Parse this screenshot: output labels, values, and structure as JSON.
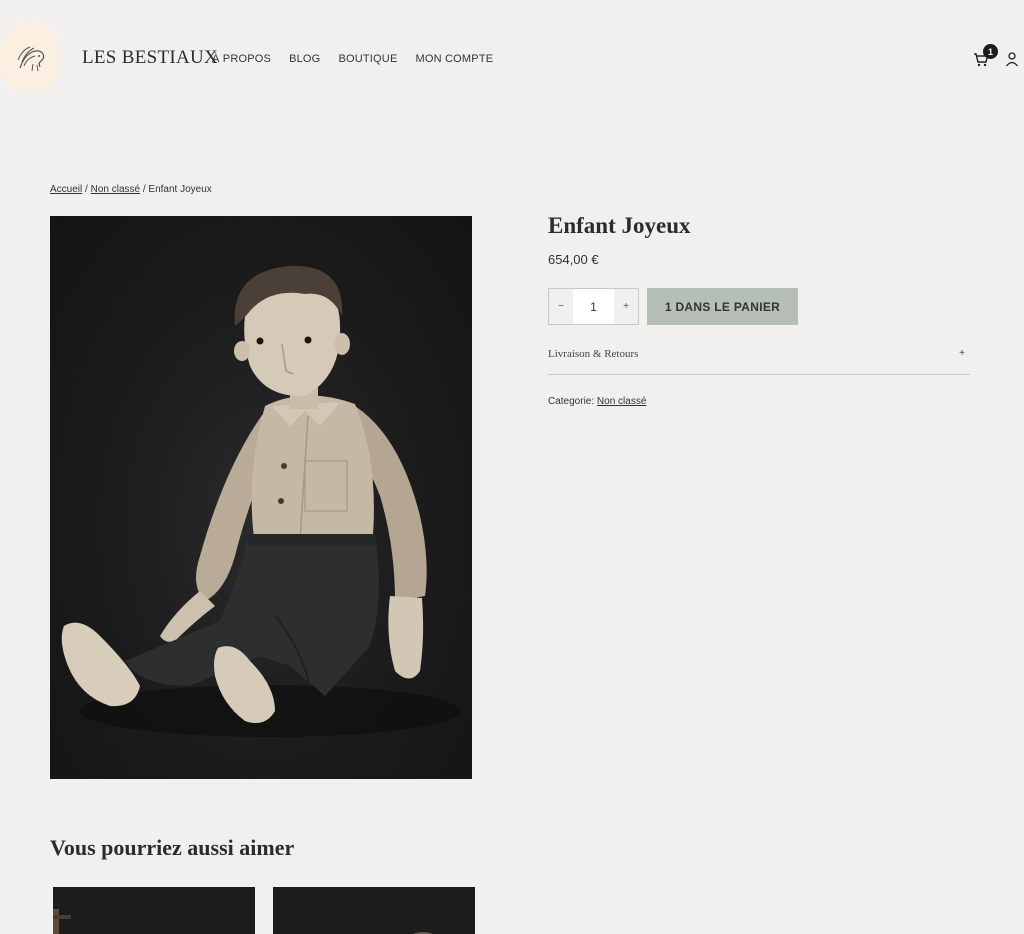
{
  "header": {
    "brand": "LES BESTIAUX",
    "nav": [
      "À PROPOS",
      "BLOG",
      "BOUTIQUE",
      "MON COMPTE"
    ],
    "cart_count": "1"
  },
  "breadcrumb": {
    "home": "Accueil",
    "sep1": " / ",
    "category": "Non classé",
    "sep2": " / ",
    "current": "Enfant Joyeux"
  },
  "product": {
    "title": "Enfant Joyeux",
    "price": "654,00 €",
    "quantity": "1",
    "qty_minus": "−",
    "qty_plus": "+",
    "add_to_cart": "1 DANS LE PANIER",
    "accordion_label": "Livraison & Retours",
    "accordion_toggle": "+",
    "category_label": "Categorie: ",
    "category_value": "Non classé"
  },
  "related": {
    "title": "Vous pourriez aussi aimer"
  },
  "colors": {
    "background": "#f2f0ef",
    "button": "#b6bfb6",
    "logo_bg": "#fbefe2"
  }
}
